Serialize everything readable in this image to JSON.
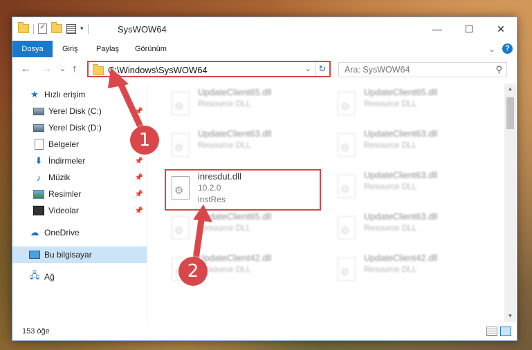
{
  "window": {
    "title": "SysWOW64",
    "controls": {
      "minimize": "—",
      "maximize": "☐",
      "close": "✕"
    },
    "qat_dropdown": "▾"
  },
  "ribbon": {
    "tabs": [
      "Dosya",
      "Giriş",
      "Paylaş",
      "Görünüm"
    ],
    "collapse": "⌄",
    "help": "?"
  },
  "navigation": {
    "back": "←",
    "forward": "→",
    "recent": "⌄",
    "up": "↑",
    "address": "C:\\Windows\\SysWOW64",
    "refresh": "↻",
    "address_dropdown": "⌄",
    "search_placeholder": "Ara: SysWOW64",
    "search_icon": "⚲"
  },
  "sidebar": {
    "items": [
      {
        "label": "Hızlı erişim",
        "icon": "star-icon",
        "pinned": false,
        "indent": false
      },
      {
        "label": "Yerel Disk (C:)",
        "icon": "disk-icon",
        "pinned": true,
        "indent": true
      },
      {
        "label": "Yerel Disk (D:)",
        "icon": "disk-icon",
        "pinned": true,
        "indent": true
      },
      {
        "label": "Belgeler",
        "icon": "documents-icon",
        "pinned": true,
        "indent": true
      },
      {
        "label": "İndirmeler",
        "icon": "download-icon",
        "pinned": true,
        "indent": true
      },
      {
        "label": "Müzik",
        "icon": "music-icon",
        "pinned": true,
        "indent": true
      },
      {
        "label": "Resimler",
        "icon": "pictures-icon",
        "pinned": true,
        "indent": true
      },
      {
        "label": "Videolar",
        "icon": "videos-icon",
        "pinned": true,
        "indent": true
      },
      {
        "label": "OneDrive",
        "icon": "onedrive-icon",
        "pinned": false,
        "indent": false
      },
      {
        "label": "Bu bilgisayar",
        "icon": "computer-icon",
        "pinned": false,
        "indent": false,
        "selected": true
      },
      {
        "label": "Ağ",
        "icon": "network-icon",
        "pinned": false,
        "indent": false
      }
    ]
  },
  "files": {
    "left": [
      {
        "name": "UpdateClient65.dll",
        "line1": "Resource DLL",
        "line2": "",
        "blurred": true
      },
      {
        "name": "UpdateClient63.dll",
        "line1": "Resource DLL",
        "line2": "",
        "blurred": true
      },
      {
        "name": "inresdut.dll",
        "line1": "10.2.0",
        "line2": "instRes",
        "blurred": false
      },
      {
        "name": "UpdateClient65.dll",
        "line1": "Resource DLL",
        "line2": "",
        "blurred": true
      },
      {
        "name": "UpdateClient42.dll",
        "line1": "Resource DLL",
        "line2": "",
        "blurred": true
      }
    ],
    "right": [
      {
        "name": "UpdateClient65.dll",
        "line1": "Resource DLL",
        "line2": "",
        "blurred": true
      },
      {
        "name": "UpdateClient63.dll",
        "line1": "Resource DLL",
        "line2": "",
        "blurred": true
      },
      {
        "name": "UpdateClient63.dll",
        "line1": "Resource DLL",
        "line2": "",
        "blurred": true
      },
      {
        "name": "UpdateClient63.dll",
        "line1": "Resource DLL",
        "line2": "",
        "blurred": true
      },
      {
        "name": "UpdateClient42.dll",
        "line1": "Resource DLL",
        "line2": "",
        "blurred": true
      }
    ]
  },
  "status": {
    "item_count": "153 öğe"
  },
  "annotations": {
    "callout_1": "1",
    "callout_2": "2",
    "color": "#d9474a"
  }
}
